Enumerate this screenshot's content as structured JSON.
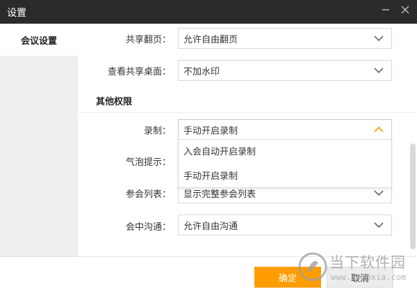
{
  "window": {
    "title": "设置",
    "minimize_icon": "minimize-icon",
    "close_icon": "close-icon"
  },
  "sidebar": {
    "items": [
      {
        "label": "会议设置",
        "selected": true
      }
    ]
  },
  "settings": {
    "rows": [
      {
        "label": "共享翻页：",
        "value": "允许自由翻页"
      },
      {
        "label": "查看共享桌面：",
        "value": "不加水印"
      },
      {
        "label": "录制：",
        "value": "手动开启录制"
      },
      {
        "label": "气泡提示：",
        "value": ""
      },
      {
        "label": "参会列表：",
        "value": "显示完整参会列表"
      },
      {
        "label": "会中沟通：",
        "value": "允许自由沟通"
      }
    ],
    "section_title": "其他权限"
  },
  "dropdown": {
    "options": [
      "入会自动开启录制",
      "手动开启录制"
    ]
  },
  "footer": {
    "ok_label": "确定",
    "cancel_label": "取消"
  },
  "watermark": {
    "text": "当下软件园",
    "sub": "www.downxia.com"
  },
  "colors": {
    "titlebar": "#2b2b2b",
    "primary_button": "#ff9c00",
    "chevron_open": "#ff9c00",
    "chevron_closed": "#666666"
  }
}
